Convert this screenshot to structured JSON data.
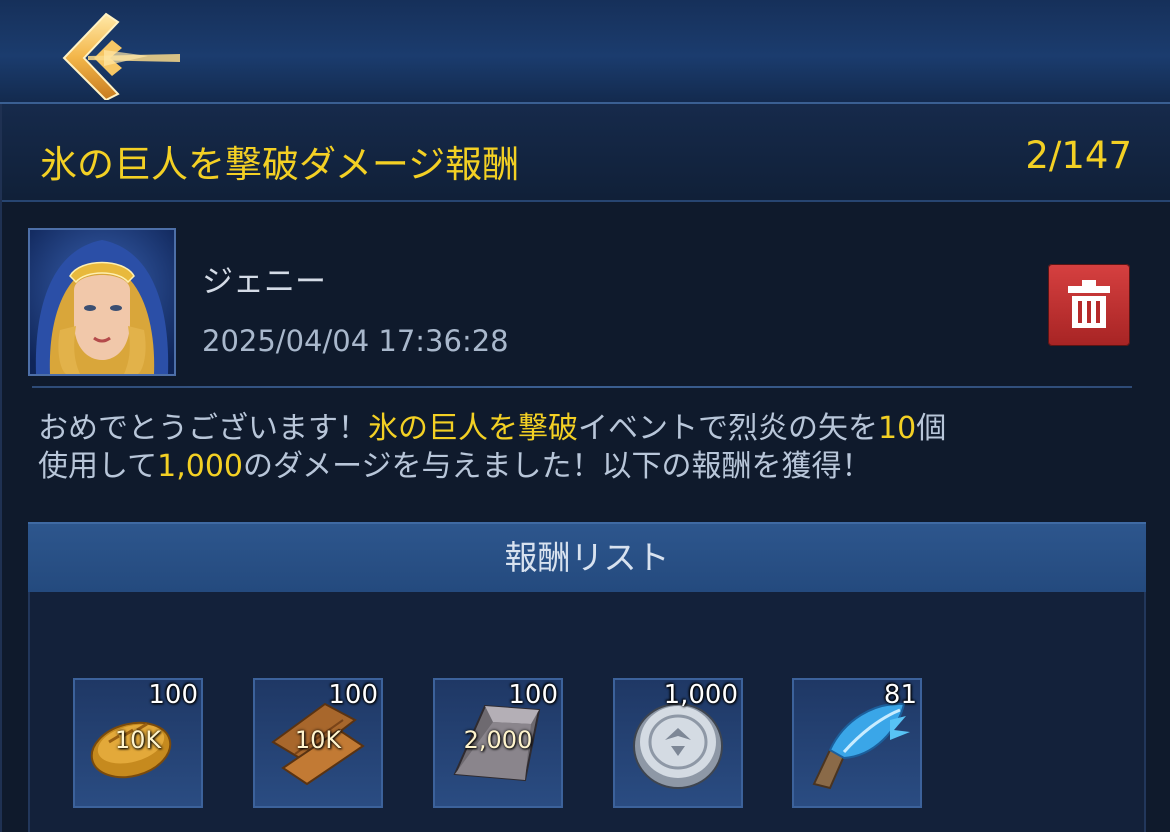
{
  "header": {
    "back_icon": "winged-back-chevron-icon"
  },
  "mail": {
    "title": "氷の巨人を撃破ダメージ報酬",
    "counter": "2/147",
    "sender": {
      "name": "ジェニー",
      "timestamp": "2025/04/04 17:36:28",
      "avatar_icon": "hooded-heroine-portrait"
    },
    "delete_icon": "trash-icon",
    "message": {
      "p1": "おめでとうございます！",
      "event": "氷の巨人を撃破",
      "p2": "イベントで烈炎の矢を",
      "count": "10",
      "p3": "個",
      "p4": "使用して",
      "damage": "1,000",
      "p5": "のダメージを与えました！以下の報酬を獲得！"
    }
  },
  "rewards": {
    "title": "報酬リスト",
    "items": [
      {
        "icon": "bread-icon",
        "quantity": "100",
        "amount": "10K"
      },
      {
        "icon": "wood-planks-icon",
        "quantity": "100",
        "amount": "10K"
      },
      {
        "icon": "iron-ingot-icon",
        "quantity": "100",
        "amount": "2,000"
      },
      {
        "icon": "silver-coin-icon",
        "quantity": "1,000",
        "amount": ""
      },
      {
        "icon": "blue-feather-icon",
        "quantity": "81",
        "amount": ""
      }
    ]
  },
  "colors": {
    "highlight": "#f3d024",
    "text": "#b8c6d9",
    "delete_red": "#c93333",
    "panel_blue": "#2a4c82"
  }
}
